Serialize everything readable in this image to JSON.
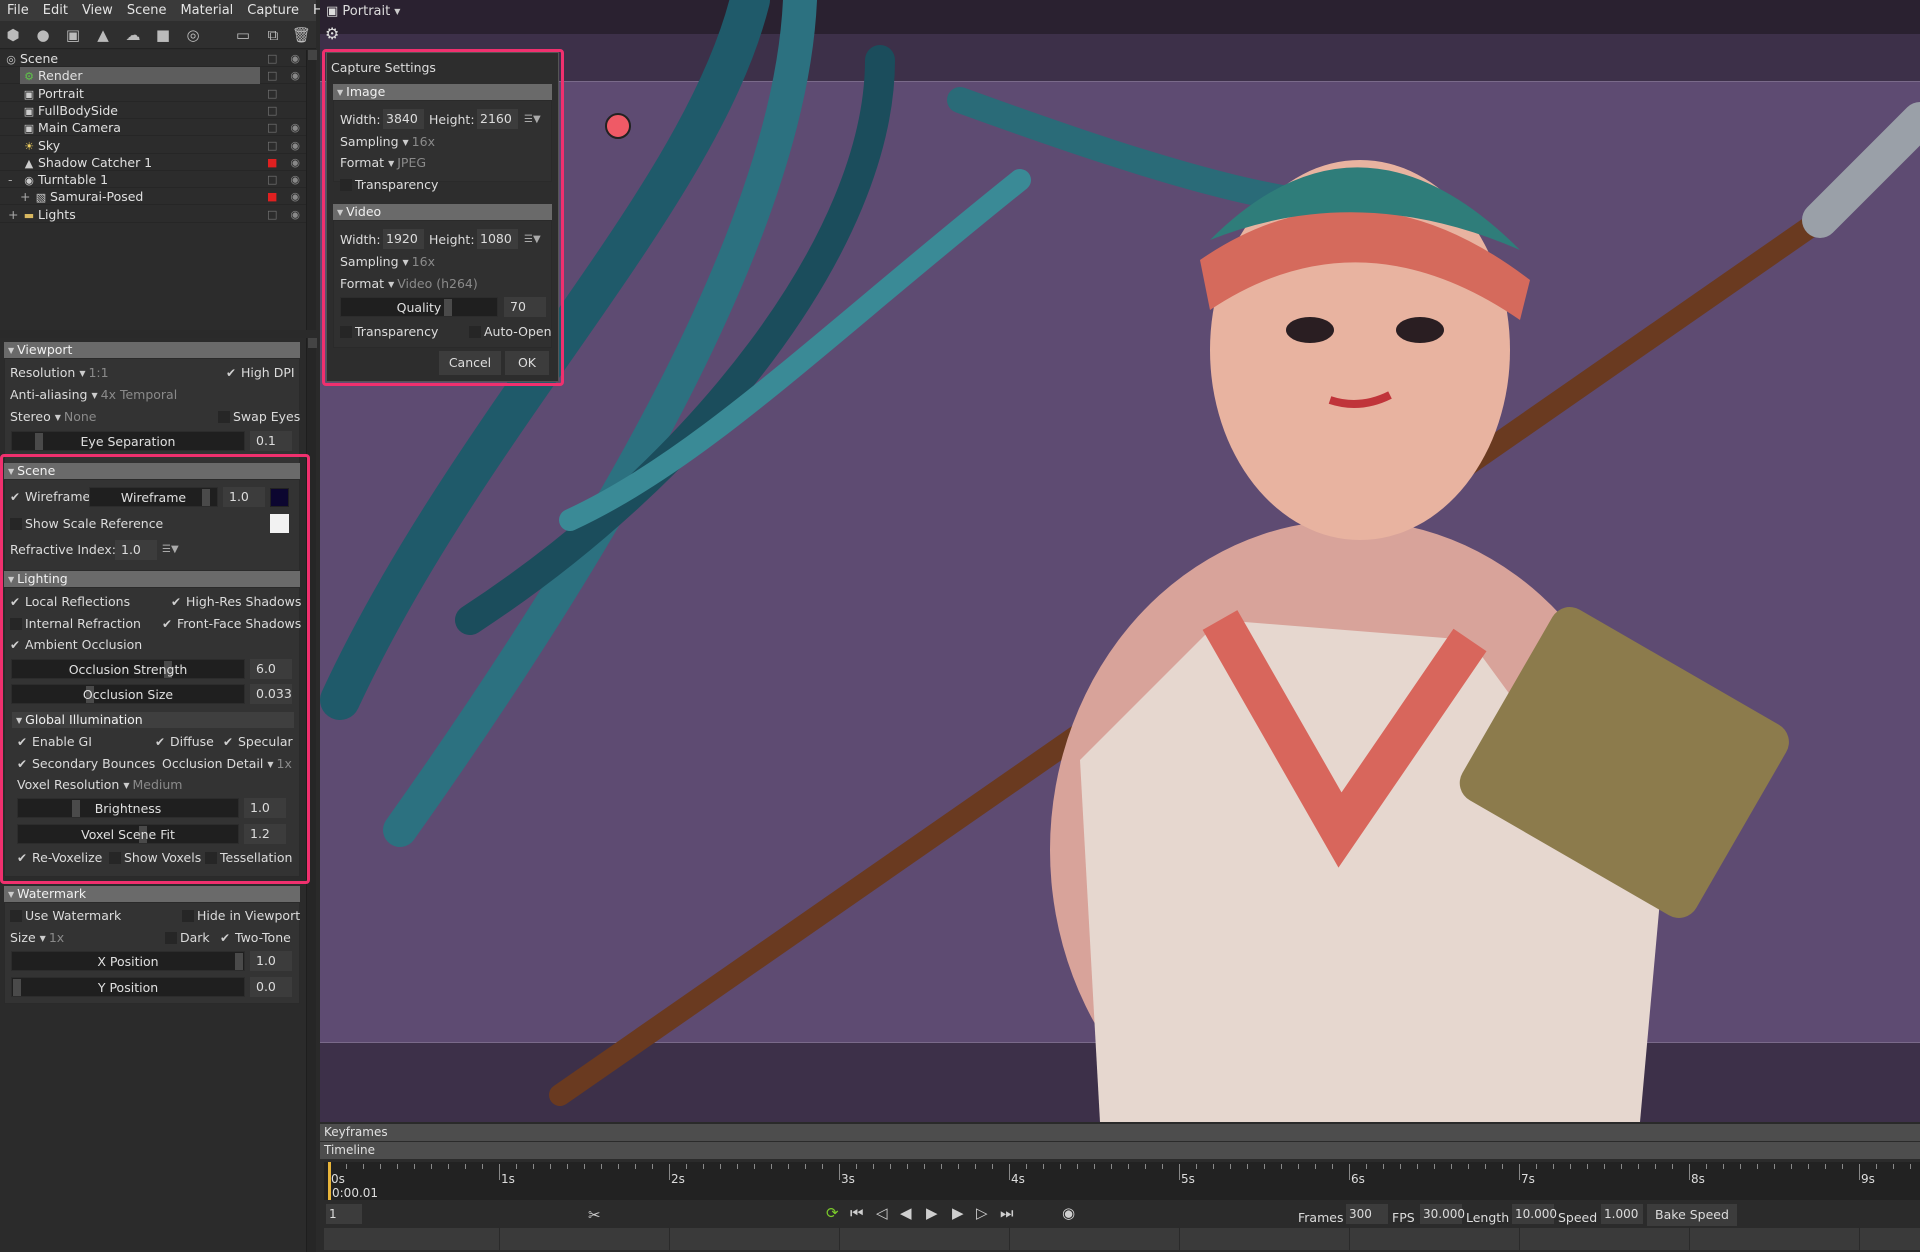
{
  "colors": {
    "accent_highlight": "#f0306e",
    "panel": "#2b2b2b",
    "viewport_bg": "#5e4b72",
    "wireframe_color": "#0c0630",
    "scale_ref_color": "#f2f2f2",
    "lock_red": "#e02020",
    "playhead": "#e8b53a",
    "loop_green": "#7ac92a"
  },
  "menu": [
    "File",
    "Edit",
    "View",
    "Scene",
    "Material",
    "Capture",
    "Help"
  ],
  "toolbar": [
    "add-object-icon",
    "add-light-icon",
    "add-camera-icon",
    "add-shadow-catcher-icon",
    "add-sky-icon",
    "add-ground-icon",
    "add-turntable-icon",
    "folder-icon",
    "duplicate-icon",
    "trash-icon"
  ],
  "tree": [
    {
      "label": "Scene",
      "icon": "scene",
      "depth": 0,
      "lock": "open",
      "eye": true,
      "expander": "-"
    },
    {
      "label": "Render",
      "icon": "render",
      "depth": 1,
      "lock": "open",
      "eye": true,
      "selected": true
    },
    {
      "label": "Portrait",
      "icon": "camera",
      "depth": 1,
      "lock": "open",
      "eye": false
    },
    {
      "label": "FullBodySide",
      "icon": "camera",
      "depth": 1,
      "lock": "open",
      "eye": false
    },
    {
      "label": "Main Camera",
      "icon": "camera",
      "depth": 1,
      "lock": "open",
      "eye": true
    },
    {
      "label": "Sky",
      "icon": "sky",
      "depth": 1,
      "lock": "open",
      "eye": true
    },
    {
      "label": "Shadow Catcher 1",
      "icon": "shadow",
      "depth": 1,
      "lock": "locked",
      "eye": true
    },
    {
      "label": "Turntable 1",
      "icon": "turntable",
      "depth": 1,
      "lock": "open",
      "eye": true,
      "expander": "-"
    },
    {
      "label": "Samurai-Posed",
      "icon": "mesh",
      "depth": 2,
      "lock": "locked",
      "eye": true,
      "expander": "+"
    },
    {
      "label": "Lights",
      "icon": "folder",
      "depth": 1,
      "lock": "open",
      "eye": true,
      "expander": "+"
    }
  ],
  "viewport_panel": {
    "title": "Viewport",
    "resolution_label": "Resolution",
    "resolution_value": "1:1",
    "high_dpi": {
      "label": "High DPI",
      "checked": true
    },
    "aa_label": "Anti-aliasing",
    "aa_value": "4x Temporal",
    "stereo_label": "Stereo",
    "stereo_value": "None",
    "swap_eyes": {
      "label": "Swap Eyes",
      "checked": false
    },
    "eye_sep": {
      "label": "Eye Separation",
      "value": "0.1",
      "level": 0.1
    }
  },
  "scene_panel": {
    "title": "Scene",
    "wireframe": {
      "label": "Wireframe",
      "checked": true,
      "slider_label": "Wireframe",
      "value": "1.0",
      "level": 0.95
    },
    "show_scale": {
      "label": "Show Scale Reference",
      "checked": false
    },
    "refractive_label": "Refractive Index:",
    "refractive_value": "1.0"
  },
  "lighting_panel": {
    "title": "Lighting",
    "local_reflections": {
      "label": "Local Reflections",
      "checked": true
    },
    "high_res_shadows": {
      "label": "High-Res Shadows",
      "checked": true
    },
    "internal_refraction": {
      "label": "Internal Refraction",
      "checked": false
    },
    "front_face_shadows": {
      "label": "Front-Face Shadows",
      "checked": true
    },
    "ambient_occlusion": {
      "label": "Ambient Occlusion",
      "checked": true
    },
    "occ_strength": {
      "label": "Occlusion Strength",
      "value": "6.0",
      "level": 0.68
    },
    "occ_size": {
      "label": "Occlusion Size",
      "value": "0.033",
      "level": 0.33
    },
    "gi": {
      "title": "Global Illumination",
      "enable_gi": {
        "label": "Enable GI",
        "checked": true
      },
      "diffuse": {
        "label": "Diffuse",
        "checked": true
      },
      "specular": {
        "label": "Specular",
        "checked": true
      },
      "secondary": {
        "label": "Secondary Bounces",
        "checked": true
      },
      "occ_detail_label": "Occlusion Detail",
      "occ_detail_value": "1x",
      "voxel_res_label": "Voxel Resolution",
      "voxel_res_value": "Medium",
      "brightness": {
        "label": "Brightness",
        "value": "1.0",
        "level": 0.25
      },
      "voxel_fit": {
        "label": "Voxel Scene Fit",
        "value": "1.2",
        "level": 0.57
      },
      "revoxelize": {
        "label": "Re-Voxelize",
        "checked": true
      },
      "show_voxels": {
        "label": "Show Voxels",
        "checked": false
      },
      "tessellation": {
        "label": "Tessellation",
        "checked": false
      }
    }
  },
  "watermark_panel": {
    "title": "Watermark",
    "use": {
      "label": "Use Watermark",
      "checked": false
    },
    "hide": {
      "label": "Hide in Viewport",
      "checked": false
    },
    "size_label": "Size",
    "size_value": "1x",
    "dark": {
      "label": "Dark",
      "checked": false
    },
    "two_tone": {
      "label": "Two-Tone",
      "checked": true
    },
    "x_pos": {
      "label": "X Position",
      "value": "1.0",
      "level": 1.0
    },
    "y_pos": {
      "label": "Y Position",
      "value": "0.0",
      "level": 0.0
    }
  },
  "viewport": {
    "camera": "Portrait"
  },
  "capture": {
    "title": "Capture Settings",
    "image": {
      "title": "Image",
      "width_label": "Width:",
      "width": "3840",
      "height_label": "Height:",
      "height": "2160",
      "sampling_label": "Sampling",
      "sampling": "16x",
      "format_label": "Format",
      "format": "JPEG",
      "transparency": {
        "label": "Transparency",
        "checked": false
      }
    },
    "video": {
      "title": "Video",
      "width_label": "Width:",
      "width": "1920",
      "height_label": "Height:",
      "height": "1080",
      "sampling_label": "Sampling",
      "sampling": "16x",
      "format_label": "Format",
      "format": "Video (h264)",
      "quality": {
        "label": "Quality",
        "value": "70",
        "level": 0.7
      },
      "transparency": {
        "label": "Transparency",
        "checked": false
      },
      "auto_open": {
        "label": "Auto-Open",
        "checked": false
      }
    },
    "cancel": "Cancel",
    "ok": "OK"
  },
  "timeline": {
    "keyframes_label": "Keyframes",
    "timeline_label": "Timeline",
    "ticks": [
      "0s",
      "1s",
      "2s",
      "3s",
      "4s",
      "5s",
      "6s",
      "7s",
      "8s",
      "9s"
    ],
    "current_time": "0:00.01",
    "frame": "1",
    "frames_label": "Frames",
    "frames": "300",
    "fps_label": "FPS",
    "fps": "30.000",
    "length_label": "Length",
    "length": "10.000",
    "speed_label": "Speed",
    "speed": "1.000",
    "bake_speed": "Bake Speed"
  }
}
